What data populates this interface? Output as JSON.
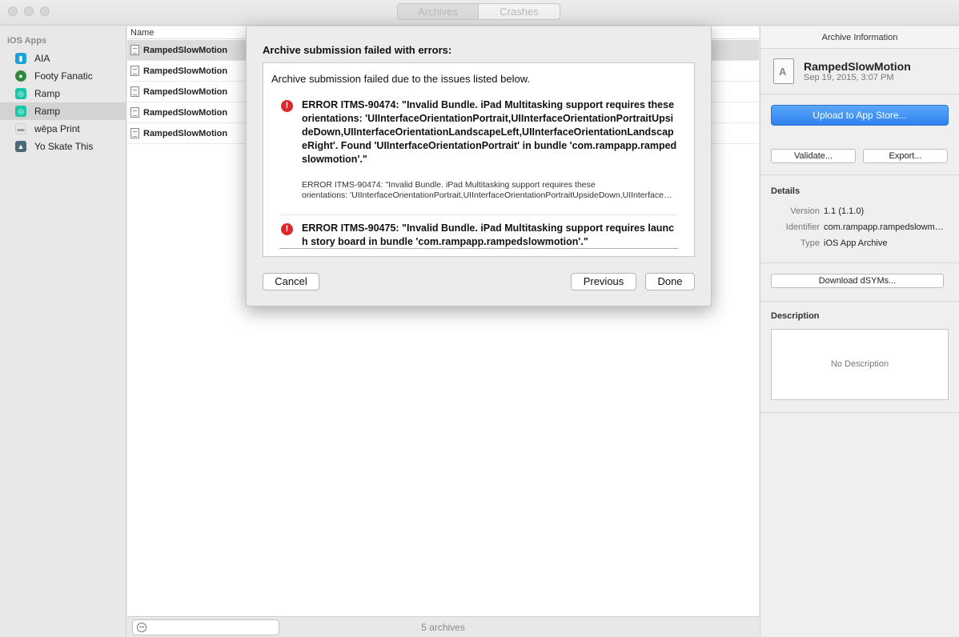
{
  "window": {
    "segments": [
      "Archives",
      "Crashes"
    ]
  },
  "sidebar": {
    "heading": "iOS Apps",
    "items": [
      {
        "label": "AIA",
        "icon": "aia-app-icon",
        "color": "#1ea0d8"
      },
      {
        "label": "Footy Fanatic",
        "icon": "footy-fanatic-app-icon",
        "color": "#2e8b3e"
      },
      {
        "label": "Ramp",
        "icon": "ramp-app-icon",
        "color": "#19c6a6"
      },
      {
        "label": "Ramp",
        "icon": "ramp-app-icon",
        "color": "#19c6a6"
      },
      {
        "label": "wēpa Print",
        "icon": "wepa-print-app-icon",
        "color": "#e8e8e8"
      },
      {
        "label": "Yo Skate This",
        "icon": "yo-skate-this-app-icon",
        "color": "#4a6a7a"
      }
    ],
    "selected_index": 3
  },
  "archive_list": {
    "column_name": "Name",
    "rows": [
      "RampedSlowMotion",
      "RampedSlowMotion",
      "RampedSlowMotion",
      "RampedSlowMotion",
      "RampedSlowMotion"
    ],
    "selected_index": 0,
    "count_label": "5 archives"
  },
  "inspector": {
    "title": "Archive Information",
    "archive_name": "RampedSlowMotion",
    "archive_date": "Sep 19, 2015, 3:07 PM",
    "upload_button": "Upload to App Store...",
    "validate_button": "Validate...",
    "export_button": "Export...",
    "details_title": "Details",
    "details": [
      {
        "key": "Version",
        "value": "1.1 (1.1.0)"
      },
      {
        "key": "Identifier",
        "value": "com.rampapp.rampedslowmotion"
      },
      {
        "key": "Type",
        "value": "iOS App Archive"
      }
    ],
    "dsyms_button": "Download dSYMs...",
    "description_title": "Description",
    "description_placeholder": "No Description"
  },
  "dialog": {
    "title": "Archive submission failed with errors:",
    "intro": "Archive submission failed due to the issues listed below.",
    "errors": [
      {
        "title": "ERROR ITMS-90474: \"Invalid Bundle. iPad Multitasking support requires these orientations: 'UIInterfaceOrientationPortrait,UIInterfaceOrientationPortraitUpsideDown,UIInterfaceOrientationLandscapeLeft,UIInterfaceOrientationLandscapeRight'. Found 'UIInterfaceOrientationPortrait' in bundle 'com.rampapp.rampedslowmotion'.\"",
        "detail_line1": "ERROR ITMS-90474: \"Invalid Bundle. iPad Multitasking support requires these",
        "detail_line2": "orientations: 'UIInterfaceOrientationPortrait,UIInterfaceOrientationPortraitUpsideDown,UIInterfaceOrientationLandscapeLeft'"
      },
      {
        "title": "ERROR ITMS-90475: \"Invalid Bundle. iPad Multitasking support requires launch story board in bundle 'com.rampapp.rampedslowmotion'.\""
      }
    ],
    "cancel_button": "Cancel",
    "previous_button": "Previous",
    "done_button": "Done"
  }
}
